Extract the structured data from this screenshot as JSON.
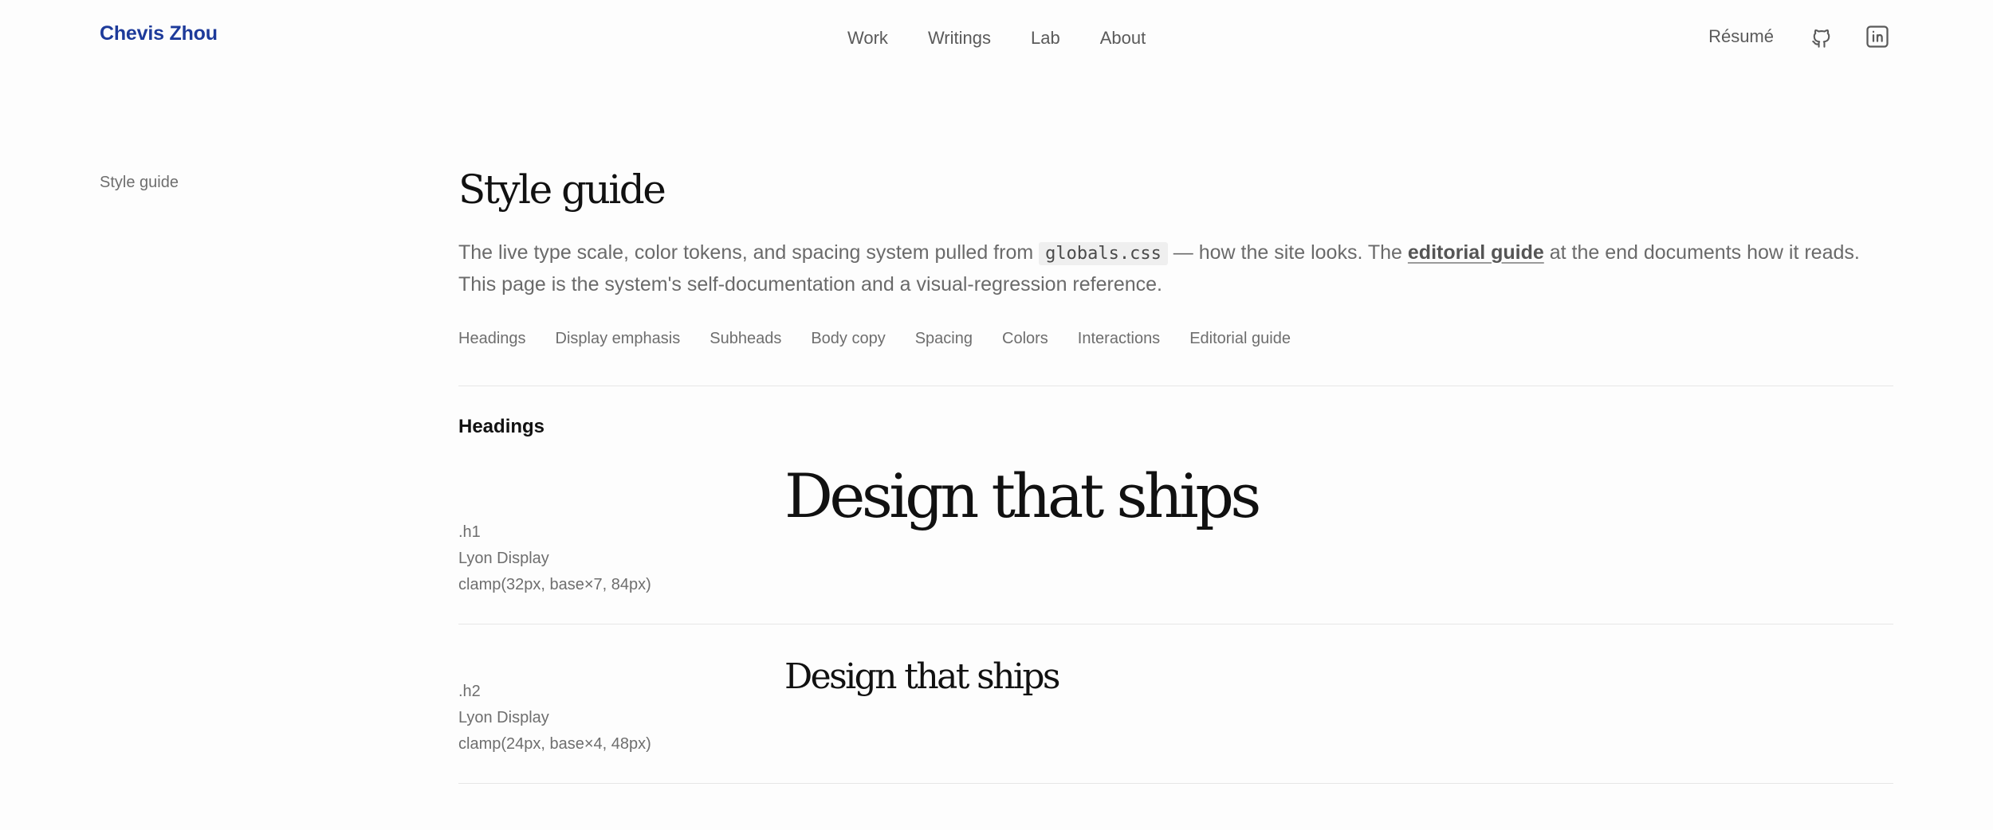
{
  "header": {
    "brand": "Chevis Zhou",
    "nav": [
      {
        "label": "Work"
      },
      {
        "label": "Writings"
      },
      {
        "label": "Lab"
      },
      {
        "label": "About"
      }
    ],
    "resume_label": "Résumé",
    "icons": [
      "github-icon",
      "linkedin-icon"
    ]
  },
  "sidebar": {
    "label": "Style guide"
  },
  "page": {
    "title": "Style guide",
    "intro": {
      "part1": "The live type scale, color tokens, and spacing system pulled from ",
      "code": "globals.css",
      "part2": " — how the site looks. The ",
      "link": "editorial guide",
      "part3": " at the end documents how it reads. This page is the system's self-documentation and a visual-regression reference."
    },
    "toc": [
      {
        "label": "Headings"
      },
      {
        "label": "Display emphasis"
      },
      {
        "label": "Subheads"
      },
      {
        "label": "Body copy"
      },
      {
        "label": "Spacing"
      },
      {
        "label": "Colors"
      },
      {
        "label": "Interactions"
      },
      {
        "label": "Editorial guide"
      }
    ]
  },
  "headings": {
    "title": "Headings",
    "rows": [
      {
        "class_name": ".h1",
        "font": "Lyon Display",
        "size": "clamp(32px, base×7, 84px)",
        "sample": "Design that ships"
      },
      {
        "class_name": ".h2",
        "font": "Lyon Display",
        "size": "clamp(24px, base×4, 48px)",
        "sample": "Design that ships"
      }
    ]
  },
  "colors": {
    "brand": "#1d3a9a",
    "text": "#6b6b6b",
    "heading": "#111111",
    "divider": "#e6e6e6",
    "code_bg": "#efefef"
  }
}
